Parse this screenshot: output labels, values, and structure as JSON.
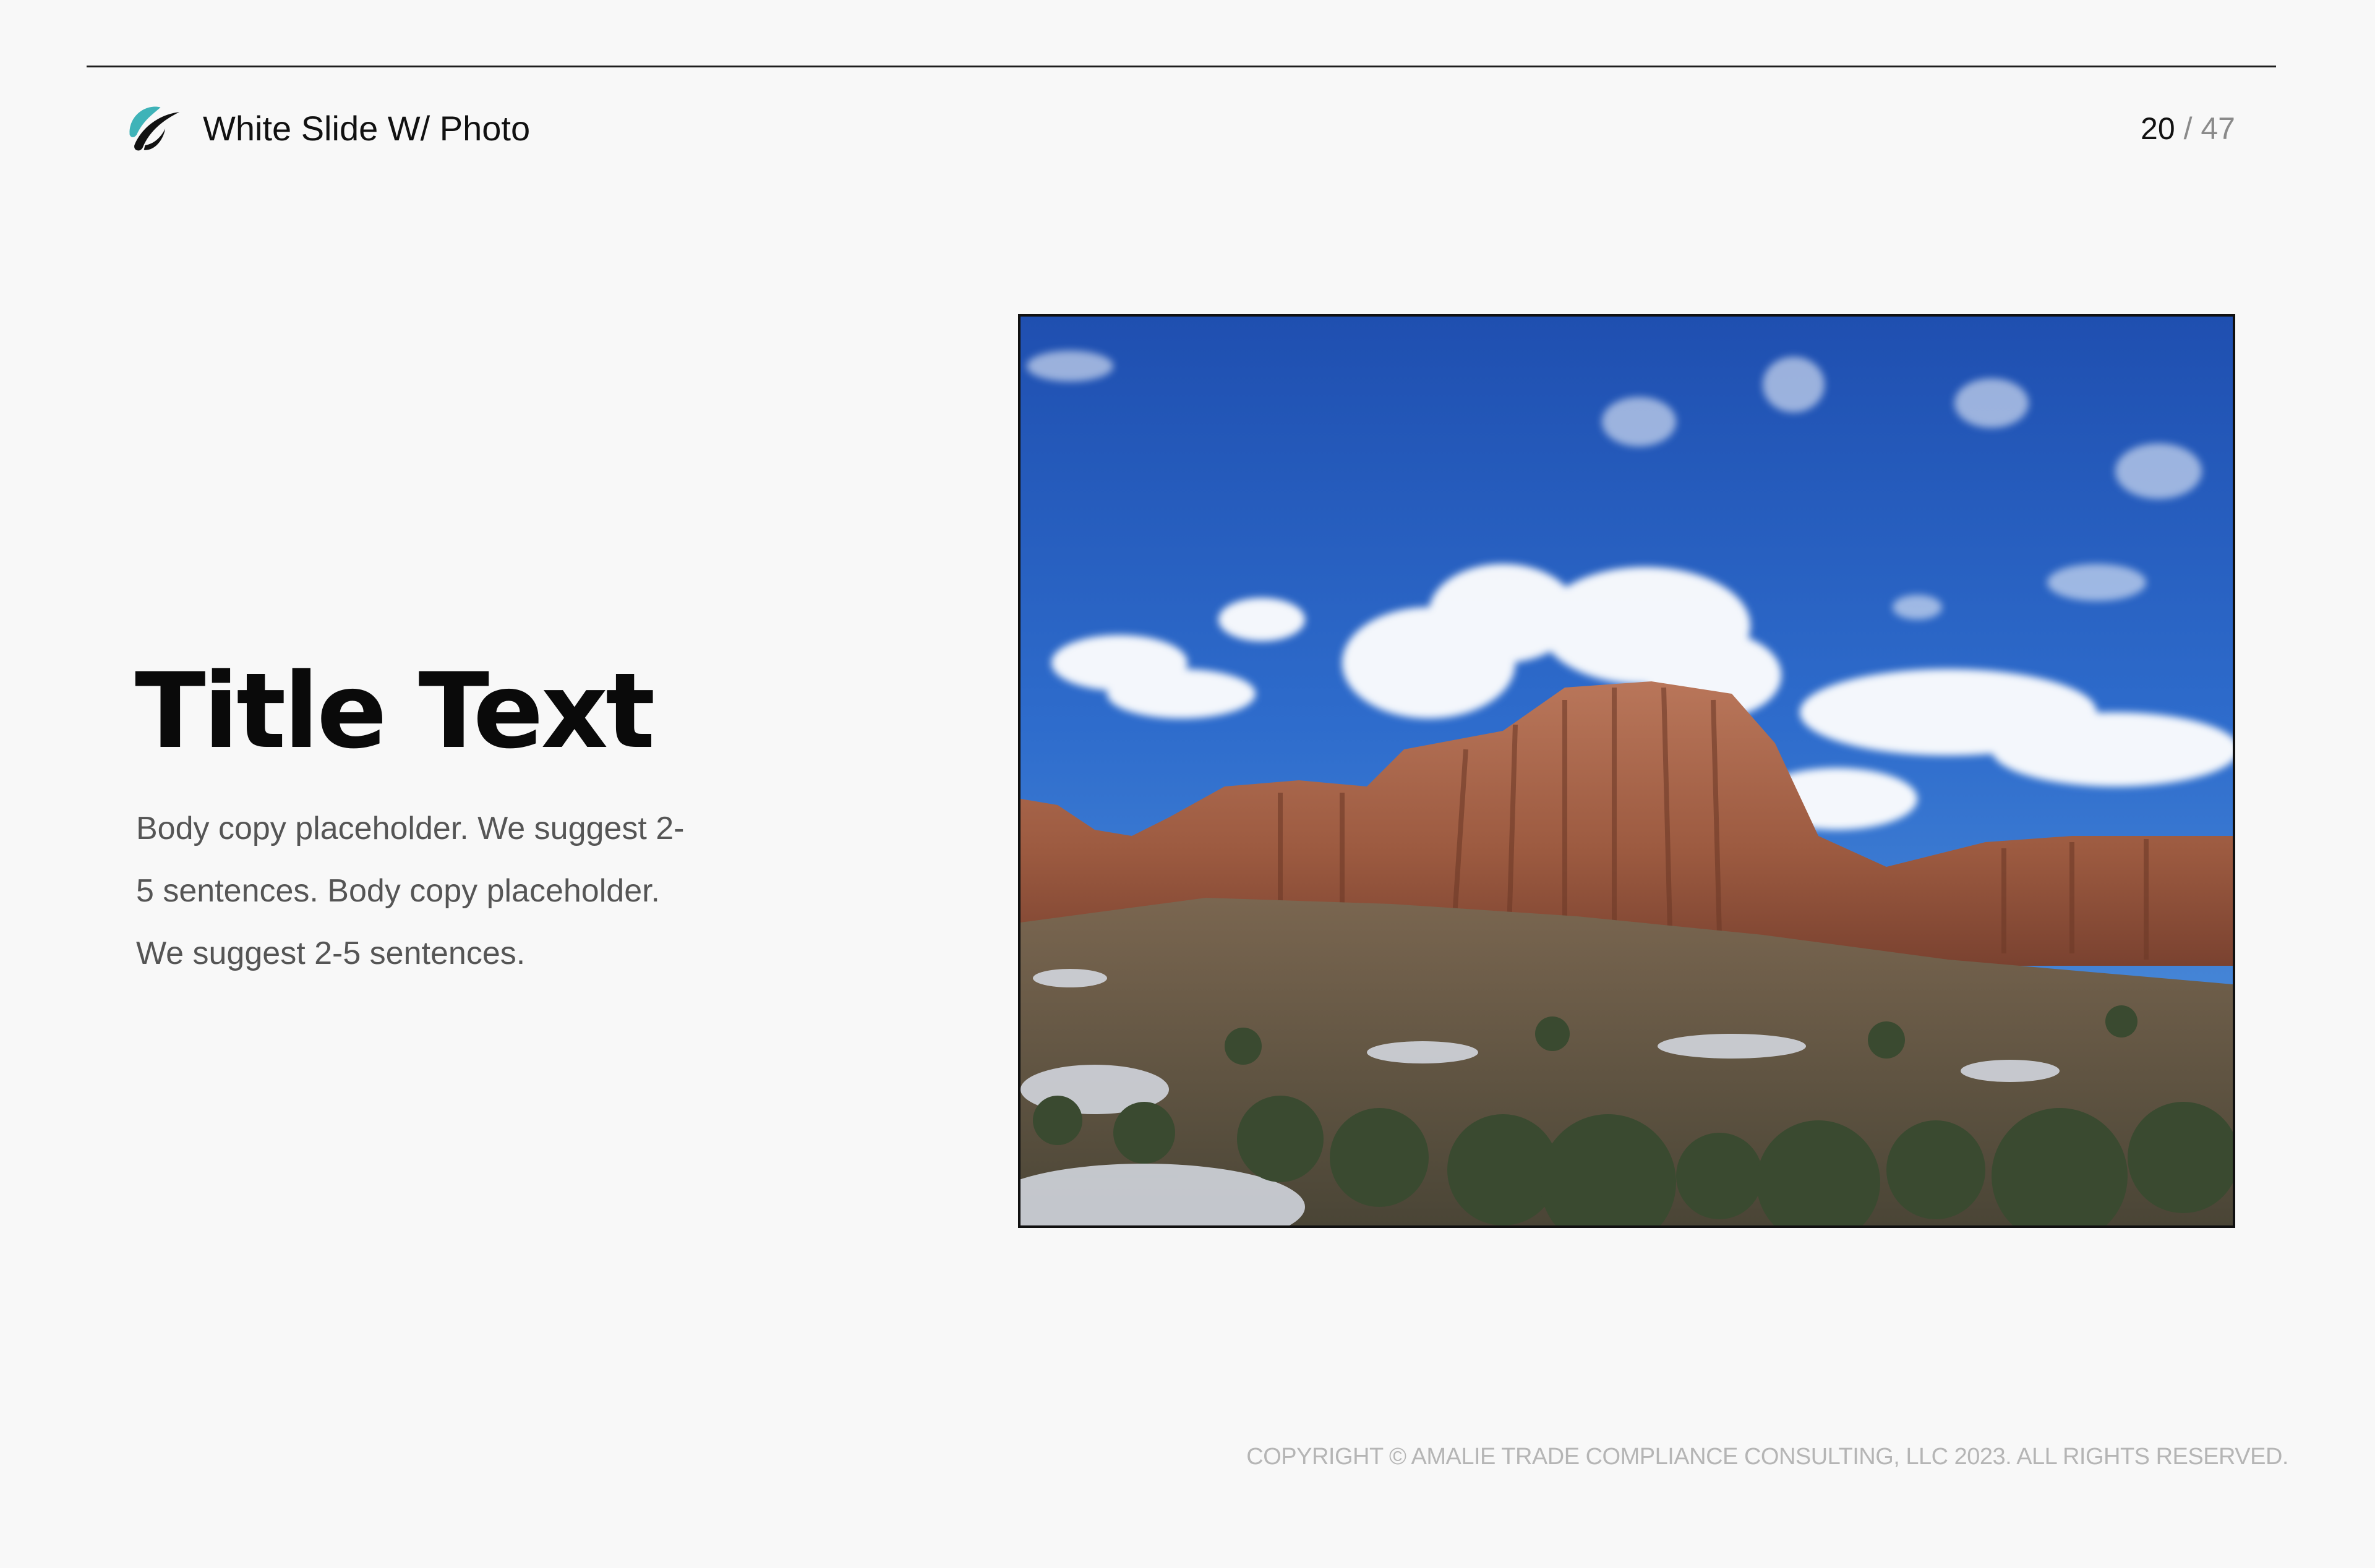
{
  "header": {
    "title": "White Slide W/ Photo",
    "logo_icon": "leaf-swoosh-icon",
    "logo_color": "#3fb3b8"
  },
  "pagination": {
    "current": "20",
    "separator": "/",
    "total": "47"
  },
  "content": {
    "title": "Title Text",
    "body": "Body copy placeholder. We suggest 2-5 sentences. Body copy placeholder. We suggest 2-5 sentences."
  },
  "photo": {
    "subject": "red-rock-mesa-landscape-image"
  },
  "footer": {
    "copyright": "COPYRIGHT © AMALIE TRADE COMPLIANCE CONSULTING, LLC 2023.  ALL RIGHTS RESERVED."
  }
}
